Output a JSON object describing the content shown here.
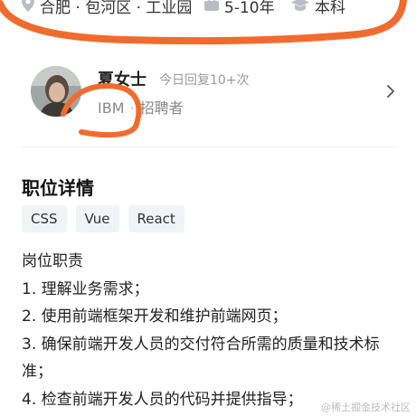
{
  "job_meta": {
    "location": "合肥 · 包河区 · 工业园",
    "experience": "5-10年",
    "education": "本科",
    "location_icon": "location-pin-icon",
    "experience_icon": "briefcase-icon",
    "education_icon": "graduation-cap-icon"
  },
  "recruiter": {
    "name": "夏女士",
    "reply_status": "今日回复10+次",
    "company": "IBM",
    "separator": "·",
    "role": "招聘者",
    "avatar_icon": "avatar-photo",
    "chevron_icon": "chevron-right-icon"
  },
  "details": {
    "title": "职位详情",
    "tags": [
      "CSS",
      "Vue",
      "React"
    ],
    "lines": [
      "岗位职责",
      "1. 理解业务需求；",
      "2. 使用前端框架开发和维护前端网页；",
      "3. 确保前端开发人员的交付符合所需的质量和技术标",
      "准；",
      "4. 检查前端开发人员的代码并提供指导；"
    ]
  },
  "watermark": "@稀土掘金技术社区",
  "colors": {
    "markup": "#f26b2e",
    "muted_text": "#888888",
    "tag_bg": "#f2f3f5"
  }
}
